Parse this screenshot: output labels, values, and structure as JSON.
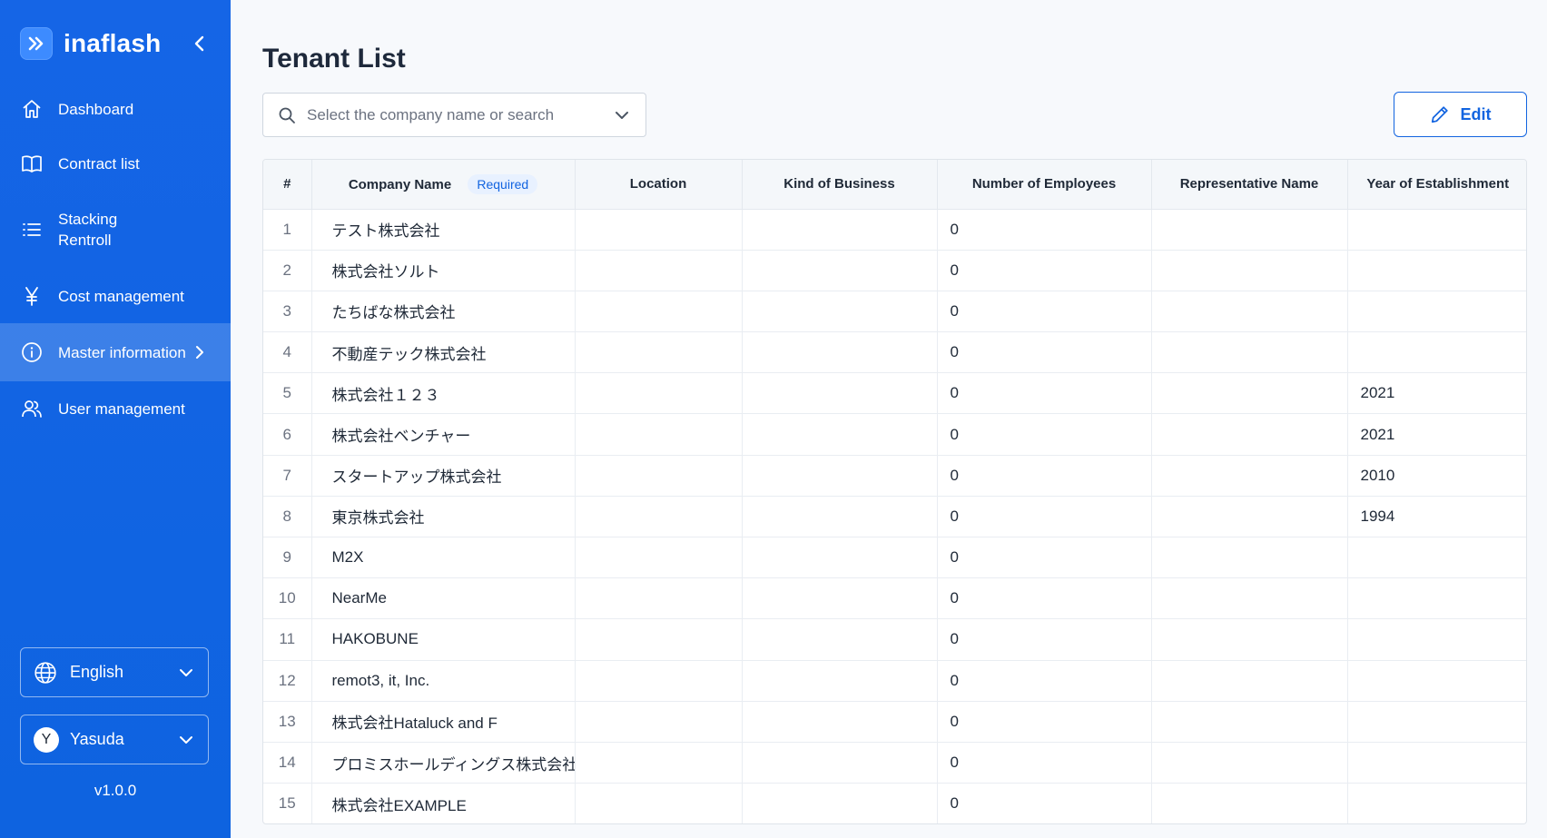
{
  "app": {
    "name": "inaflash"
  },
  "sidebar": {
    "items": [
      {
        "label": "Dashboard",
        "icon": "home-icon"
      },
      {
        "label": "Contract list",
        "icon": "book-icon"
      },
      {
        "label": "Stacking\nRentroll",
        "icon": "list-icon"
      },
      {
        "label": "Cost management",
        "icon": "yen-icon"
      },
      {
        "label": "Master information",
        "icon": "info-icon",
        "active": true
      },
      {
        "label": "User management",
        "icon": "users-icon"
      }
    ],
    "language": "English",
    "user": {
      "initial": "Y",
      "name": "Yasuda"
    },
    "version": "v1.0.0"
  },
  "page": {
    "title": "Tenant List",
    "search_placeholder": "Select the company name or search",
    "edit_label": "Edit"
  },
  "table": {
    "columns": [
      "#",
      "Company Name",
      "Location",
      "Kind of Business",
      "Number of Employees",
      "Representative Name",
      "Year of Establishment"
    ],
    "required_badge": "Required",
    "rows": [
      {
        "num": "1",
        "company": "テスト株式会社",
        "location": "",
        "business": "",
        "employees": "0",
        "representative": "",
        "year": ""
      },
      {
        "num": "2",
        "company": "株式会社ソルト",
        "location": "",
        "business": "",
        "employees": "0",
        "representative": "",
        "year": ""
      },
      {
        "num": "3",
        "company": "たちばな株式会社",
        "location": "",
        "business": "",
        "employees": "0",
        "representative": "",
        "year": ""
      },
      {
        "num": "4",
        "company": "不動産テック株式会社",
        "location": "",
        "business": "",
        "employees": "0",
        "representative": "",
        "year": ""
      },
      {
        "num": "5",
        "company": "株式会社１２３",
        "location": "",
        "business": "",
        "employees": "0",
        "representative": "",
        "year": "2021"
      },
      {
        "num": "6",
        "company": "株式会社ベンチャー",
        "location": "",
        "business": "",
        "employees": "0",
        "representative": "",
        "year": "2021"
      },
      {
        "num": "7",
        "company": "スタートアップ株式会社",
        "location": "",
        "business": "",
        "employees": "0",
        "representative": "",
        "year": "2010"
      },
      {
        "num": "8",
        "company": "東京株式会社",
        "location": "",
        "business": "",
        "employees": "0",
        "representative": "",
        "year": "1994"
      },
      {
        "num": "9",
        "company": "M2X",
        "location": "",
        "business": "",
        "employees": "0",
        "representative": "",
        "year": ""
      },
      {
        "num": "10",
        "company": "NearMe",
        "location": "",
        "business": "",
        "employees": "0",
        "representative": "",
        "year": ""
      },
      {
        "num": "11",
        "company": "HAKOBUNE",
        "location": "",
        "business": "",
        "employees": "0",
        "representative": "",
        "year": ""
      },
      {
        "num": "12",
        "company": "remot3, it, Inc.",
        "location": "",
        "business": "",
        "employees": "0",
        "representative": "",
        "year": ""
      },
      {
        "num": "13",
        "company": "株式会社Hataluck and F",
        "location": "",
        "business": "",
        "employees": "0",
        "representative": "",
        "year": ""
      },
      {
        "num": "14",
        "company": "プロミスホールディングス株式会社",
        "location": "",
        "business": "",
        "employees": "0",
        "representative": "",
        "year": ""
      },
      {
        "num": "15",
        "company": "株式会社EXAMPLE",
        "location": "",
        "business": "",
        "employees": "0",
        "representative": "",
        "year": ""
      }
    ]
  },
  "colors": {
    "sidebar": "#1565e6",
    "accent": "#1264e0"
  }
}
